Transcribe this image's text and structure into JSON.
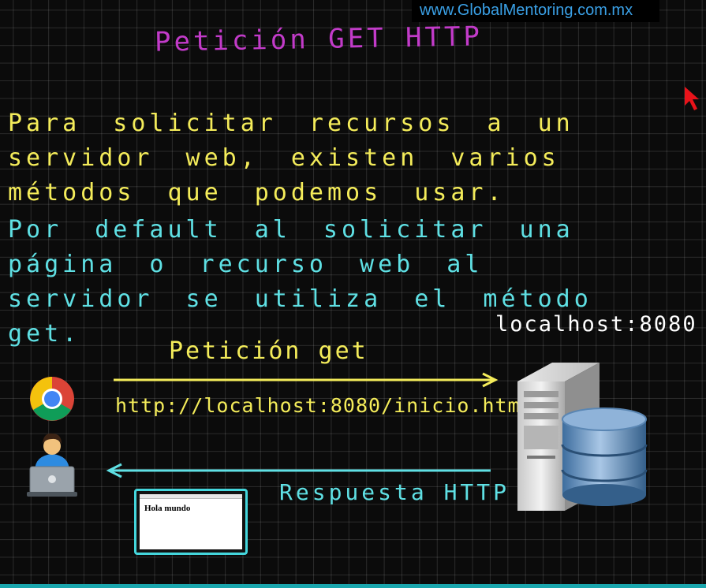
{
  "watermark": "www.GlobalMentoring.com.mx",
  "title": "Petición GET HTTP",
  "paragraph1": "Para solicitar recursos a un servidor web, existen varios métodos que podemos usar.",
  "paragraph2": "Por default al solicitar una página o recurso web al servidor se utiliza el método get.",
  "server_label": "localhost:8080",
  "request_label": "Petición get",
  "request_url": "http://localhost:8080/inicio.html",
  "response_label": "Respuesta HTTP",
  "browser_window_text": "Hola mundo",
  "icons": {
    "browser": "chrome-logo-icon",
    "user": "user-laptop-icon",
    "server": "server-database-icon",
    "cursor": "red-pointer-cursor-icon"
  },
  "colors": {
    "title": "#c23bc9",
    "paragraph1": "#f4ec5a",
    "paragraph2": "#5fe0e4",
    "request": "#f4ec5a",
    "response": "#5fe0e4",
    "watermark": "#3aa0e6",
    "cursor": "#e8131a"
  }
}
